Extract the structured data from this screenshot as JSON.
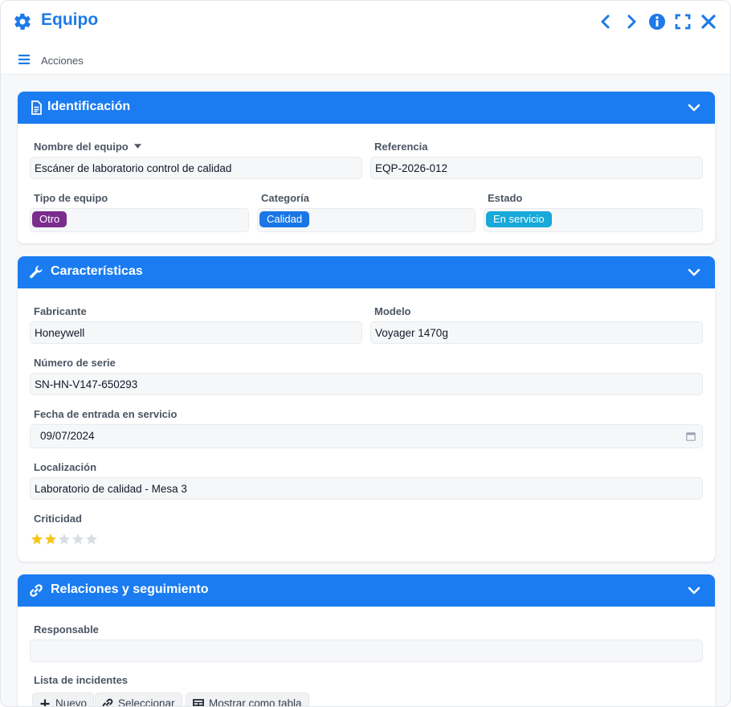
{
  "window": {
    "title": "Equipo",
    "icons": [
      "gear-icon",
      "chevron-left-icon",
      "chevron-right-icon",
      "info-icon",
      "fullscreen-icon",
      "close-icon"
    ]
  },
  "toolbar": {
    "actions_label": "Acciones"
  },
  "colors": {
    "accent": "#1a7cf0",
    "tag_otro": "#7a2d8c",
    "tag_calidad": "#1a76e6",
    "tag_en_servicio": "#17a9d8",
    "star_filled": "#f5c518",
    "star_empty": "#d9dce0"
  },
  "identificacion": {
    "title": "Identificación",
    "nombre_label": "Nombre del equipo",
    "nombre_value": "Escáner de laboratorio control de calidad",
    "referencia_label": "Referencia",
    "referencia_value": "EQP-2026-012",
    "tipo_label": "Tipo de equipo",
    "tipo_value": "Otro",
    "categoria_label": "Categoría",
    "categoria_value": "Calidad",
    "estado_label": "Estado",
    "estado_value": "En servicio"
  },
  "caracteristicas": {
    "title": "Características",
    "fabricante_label": "Fabricante",
    "fabricante_value": "Honeywell",
    "modelo_label": "Modelo",
    "modelo_value": "Voyager 1470g",
    "serie_label": "Número de serie",
    "serie_value": "SN-HN-V147-650293",
    "fecha_label": "Fecha de entrada en servicio",
    "fecha_value": "09/07/2024",
    "localizacion_label": "Localización",
    "localizacion_value": "Laboratorio de calidad - Mesa 3",
    "criticidad_label": "Criticidad",
    "criticidad_value": 2,
    "criticidad_max": 5
  },
  "relaciones": {
    "title": "Relaciones y seguimiento",
    "responsable_label": "Responsable",
    "responsable_value": "",
    "incidentes_label": "Lista de incidentes",
    "btn_nuevo": "Nuevo",
    "btn_seleccionar": "Seleccionar",
    "btn_tabla": "Mostrar como tabla"
  }
}
